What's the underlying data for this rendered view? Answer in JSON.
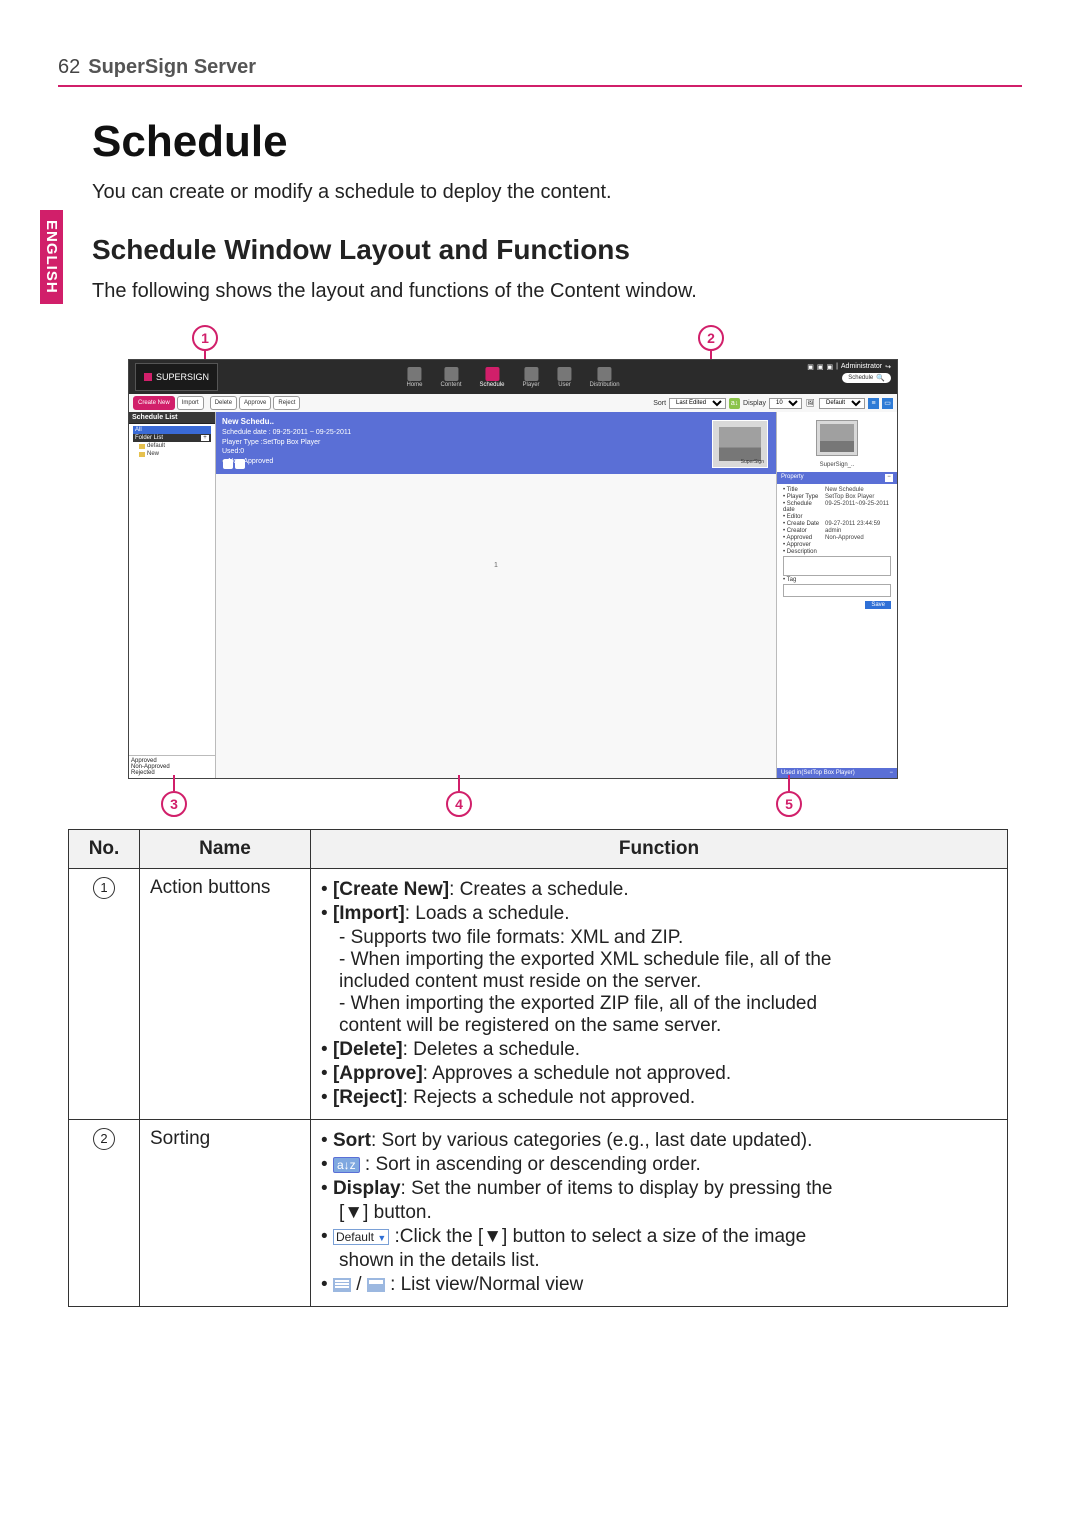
{
  "header": {
    "page_number": "62",
    "title": "SuperSign Server"
  },
  "lang_tab": "ENGLISH",
  "section": {
    "title": "Schedule",
    "intro": "You can create or modify a schedule to deploy the content."
  },
  "subsection": {
    "title": "Schedule Window Layout and Functions",
    "text": "The following shows the layout and functions of the Content window."
  },
  "callouts": {
    "c1": "1",
    "c2": "2",
    "c3": "3",
    "c4": "4",
    "c5": "5"
  },
  "shot": {
    "logo": "SUPERSIGN",
    "nav": {
      "home": "Home",
      "content": "Content",
      "schedule": "Schedule",
      "player": "Player",
      "user": "User",
      "distribution": "Distribution"
    },
    "admin": "Administrator",
    "search_placeholder": "Schedule",
    "toolbar_left": {
      "create_new": "Create New",
      "import": "Import",
      "delete": "Delete",
      "approve": "Approve",
      "reject": "Reject"
    },
    "toolbar_right": {
      "sort": "Sort",
      "sort_sel": "Last Edited",
      "display": "Display",
      "display_sel": "10",
      "size_sel": "Default"
    },
    "sidebar": {
      "header": "Schedule List",
      "all": "All",
      "folder_list": "Folder List",
      "default": "default",
      "new": "New",
      "plus": "+",
      "status": {
        "approved": "Approved",
        "nonapproved": "Non-Approved",
        "rejected": "Rejected"
      }
    },
    "strip": {
      "title": "New Schedu..",
      "dates": "Schedule date : 09-25-2011 ~ 09-25-2011",
      "ptype": "Player Type :SetTop Box Player",
      "used": "Used:0",
      "nonap": "Non-Approved",
      "thumb_label": "SuperSign"
    },
    "page_indicator": "1",
    "rightpane": {
      "thumb_title": "SuperSign_..",
      "bar": "Property",
      "props": {
        "title_k": "Title",
        "title_v": "New Schedule",
        "ptype_k": "Player Type",
        "ptype_v": "SetTop Box Player",
        "sched_k": "Schedule date",
        "sched_v": "09-25-2011~09-25-2011",
        "editor_k": "Editor",
        "editor_v": "",
        "cdate_k": "Create Date",
        "cdate_v": "09-27-2011 23:44:59",
        "creator_k": "Creator",
        "creator_v": "admin",
        "approved_k": "Approved",
        "approved_v": "Non-Approved",
        "approver_k": "Approver",
        "approver_v": "",
        "desc_k": "Description",
        "tag_k": "Tag"
      },
      "save": "Save",
      "footer": "Used in(SetTop Box Player)"
    }
  },
  "table": {
    "headers": {
      "no": "No.",
      "name": "Name",
      "function": "Function"
    },
    "row1": {
      "num": "1",
      "name": "Action buttons",
      "f": {
        "l1a": "[Create New]",
        "l1b": ": Creates a schedule.",
        "l2a": "[Import]",
        "l2b": ": Loads a schedule.",
        "l2s1": "- Supports two file formats: XML and ZIP.",
        "l2s2a": "- When importing the exported XML schedule file, all of the",
        "l2s2b": "included content must reside on the server.",
        "l2s3a": "- When importing the exported ZIP file, all of the included",
        "l2s3b": "content will be registered on the same server.",
        "l3a": "[Delete]",
        "l3b": ": Deletes a schedule.",
        "l4a": "[Approve]",
        "l4b": ": Approves a schedule not approved.",
        "l5a": "[Reject]",
        "l5b": ": Rejects a schedule not approved."
      }
    },
    "row2": {
      "num": "2",
      "name": "Sorting",
      "f": {
        "l1a": "Sort",
        "l1b": ": Sort by various categories (e.g., last date updated).",
        "l2txt": " : Sort in ascending or descending order.",
        "l2icon": "a↓z",
        "l3a": "Display",
        "l3b": ": Set the number of items to display by pressing the",
        "l3c": "[▼] button.",
        "l4sel": "Default",
        "l4a": " :Click the [▼] button to select a size of the image",
        "l4b": "shown in the details list.",
        "l5": " : List view/Normal view"
      }
    }
  }
}
